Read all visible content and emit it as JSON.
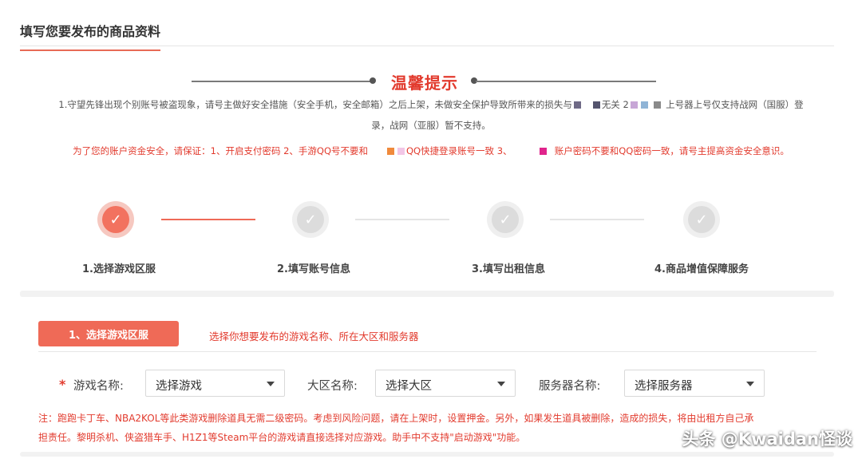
{
  "header": {
    "title": "填写您要发布的商品资料"
  },
  "tips": {
    "title": "温馨提示",
    "line1": "1.守望先锋出现个别账号被盗现象，请号主做好安全措施（安全手机，安全邮箱）之后上架，未做安全保护导致所带来的损失与",
    "line1_b": "无关 2",
    "line1_c": "上号器上号仅支持战网（国服）登",
    "line2": "录，战网（亚服）暂不支持。",
    "warn_a": "为了您的账户资金安全，请保证：1、开启支付密码 2、手游QQ号不要和",
    "warn_b": "QQ快捷登录账号一致 3、",
    "warn_c": "账户密码不要和QQ密码一致，请号主提高资金安全意识。"
  },
  "steps": [
    {
      "label": "1.选择游戏区服",
      "state": "active",
      "icon": "check-icon"
    },
    {
      "label": "2.填写账号信息",
      "state": "idle",
      "icon": "check-icon"
    },
    {
      "label": "3.填写出租信息",
      "state": "idle",
      "icon": "check-icon"
    },
    {
      "label": "4.商品增值保障服务",
      "state": "idle",
      "icon": "check-icon"
    }
  ],
  "section": {
    "tab_label": "1、选择游戏区服",
    "description": "选择你想要发布的游戏名称、所在大区和服务器"
  },
  "form": {
    "required_mark": "*",
    "game": {
      "label": "游戏名称:",
      "value": "选择游戏"
    },
    "region": {
      "label": "大区名称:",
      "value": "选择大区"
    },
    "server": {
      "label": "服务器名称:",
      "value": "选择服务器"
    }
  },
  "note": {
    "line1": "注：跑跑卡丁车、NBA2KOL等此类游戏删除道具无需二级密码。考虑到风险问题，请在上架时，设置押金。另外，如果发生道具被删除，造成的损失，将由出租方自己承",
    "line2": "担责任。黎明杀机、侠盗猎车手、H1Z1等Steam平台的游戏请直接选择对应游戏。助手中不支持\"启动游戏\"功能。"
  },
  "watermark": "头条 @Kwaidan怪谈",
  "colors": {
    "accent": "#ef6a57",
    "warning": "#e23b2e",
    "idle": "#dcdcdc"
  }
}
